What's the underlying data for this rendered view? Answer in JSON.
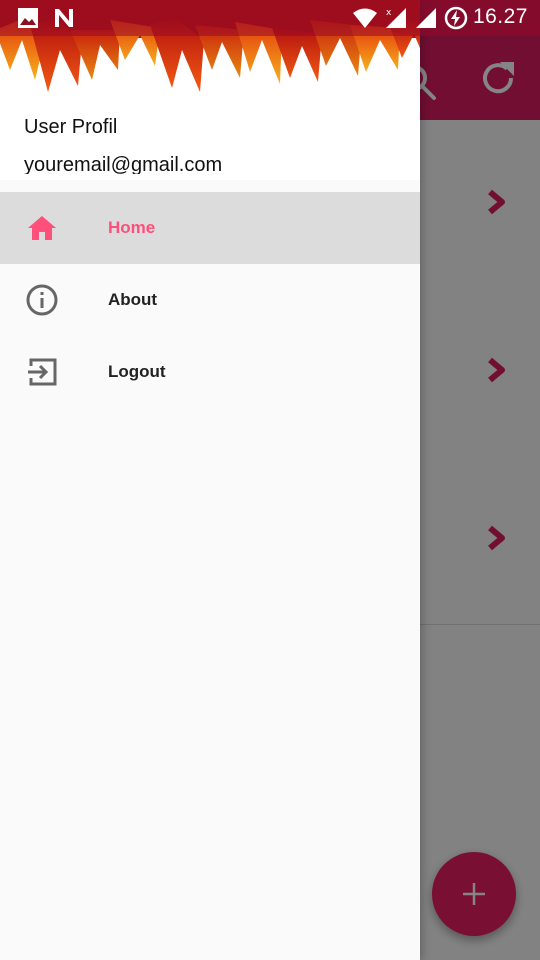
{
  "status_bar": {
    "time": "16.27",
    "icons": [
      "gallery-icon",
      "n-notification-icon",
      "wifi-icon",
      "signal-x-icon",
      "signal-icon",
      "battery-charging-icon"
    ]
  },
  "background_app": {
    "toolbar_icons": [
      "search-icon",
      "refresh-icon"
    ],
    "rows": 3,
    "fab_symbol": "+",
    "accent_color": "#d81b60"
  },
  "drawer": {
    "user_name": "User Profil",
    "user_email": "youremail@gmail.com",
    "items": [
      {
        "label": "Home",
        "icon": "home-icon",
        "active": true
      },
      {
        "label": "About",
        "icon": "info-icon",
        "active": false
      },
      {
        "label": "Logout",
        "icon": "logout-icon",
        "active": false
      }
    ],
    "active_color": "#ff4f7b"
  }
}
